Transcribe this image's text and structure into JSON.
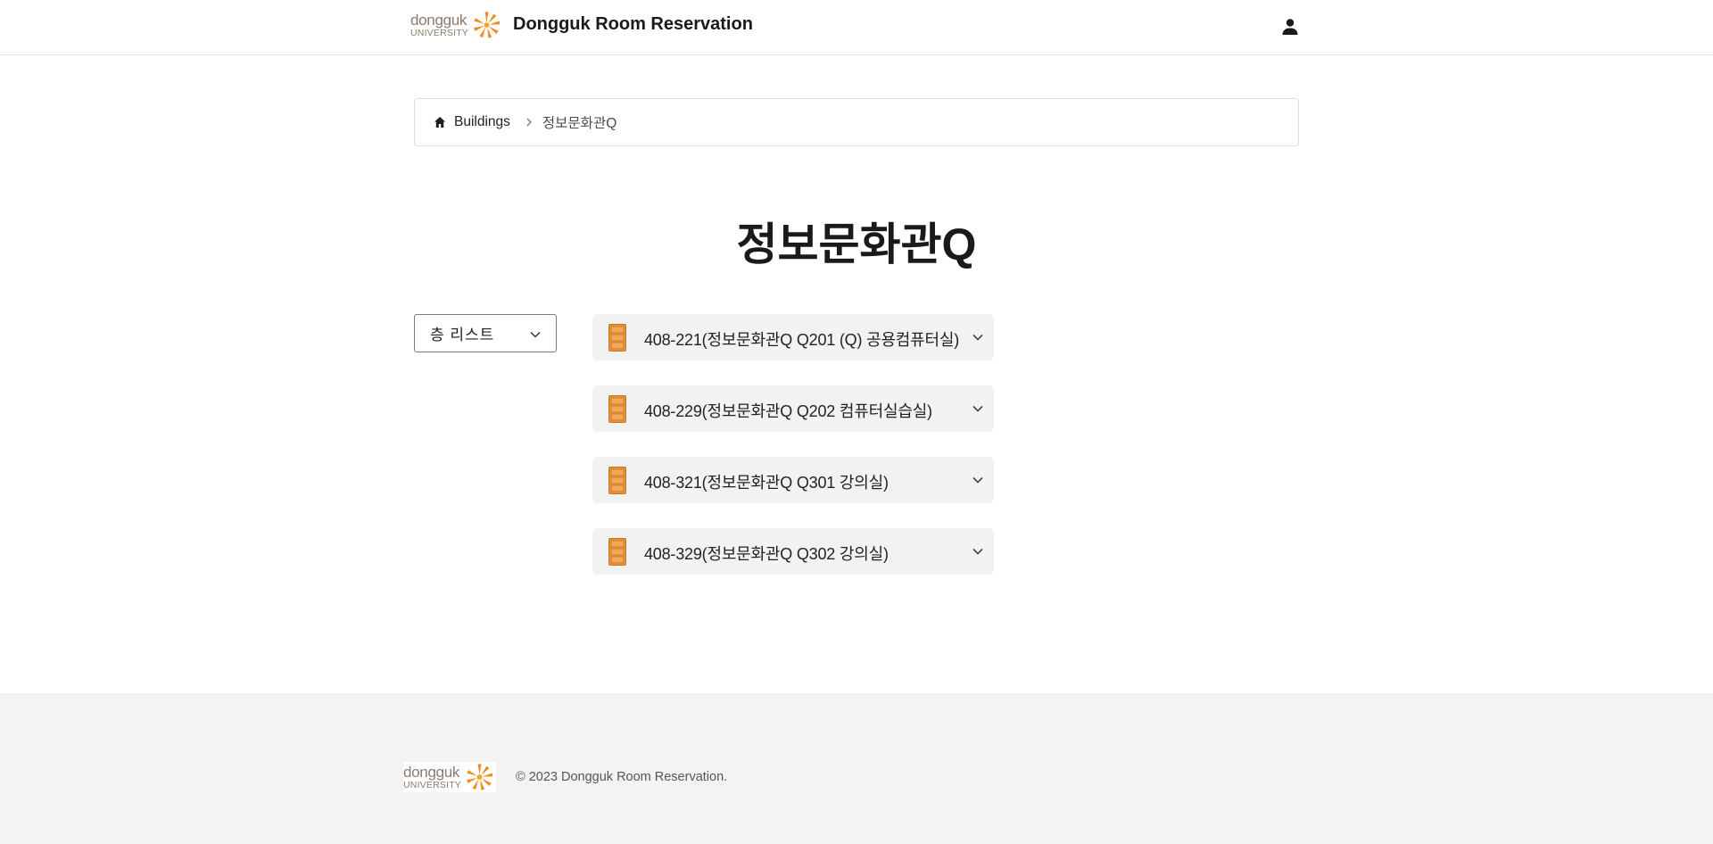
{
  "header": {
    "logo_word": "dongguk",
    "logo_sub": "UNIVERSITY",
    "title": "Dongguk Room Reservation",
    "user_icon": "user-icon"
  },
  "breadcrumb": {
    "home_icon": "home-icon",
    "root_label": "Buildings",
    "separator_icon": "chevron-right-icon",
    "current_label": "정보문화관Q"
  },
  "page": {
    "title": "정보문화관Q"
  },
  "floor_select": {
    "label": "층 리스트",
    "icon": "chevron-down-icon"
  },
  "rooms": [
    {
      "name": "408-221(정보문화관Q Q201 (Q) 공용컴퓨터실)",
      "icon": "door-icon"
    },
    {
      "name": "408-229(정보문화관Q Q202 컴퓨터실습실)",
      "icon": "door-icon"
    },
    {
      "name": "408-321(정보문화관Q Q301 강의실)",
      "icon": "door-icon"
    },
    {
      "name": "408-329(정보문화관Q Q302 강의실)",
      "icon": "door-icon"
    }
  ],
  "footer": {
    "logo_word": "dongguk",
    "logo_sub": "UNIVERSITY",
    "copyright": "© 2023 Dongguk Room Reservation."
  },
  "colors": {
    "logo_brown": "#8c7a6a",
    "logo_orange": "#f08a1c",
    "door_orange": "#e8943a",
    "card_bg": "#f2f2f2",
    "footer_bg": "#f3f3f3"
  }
}
